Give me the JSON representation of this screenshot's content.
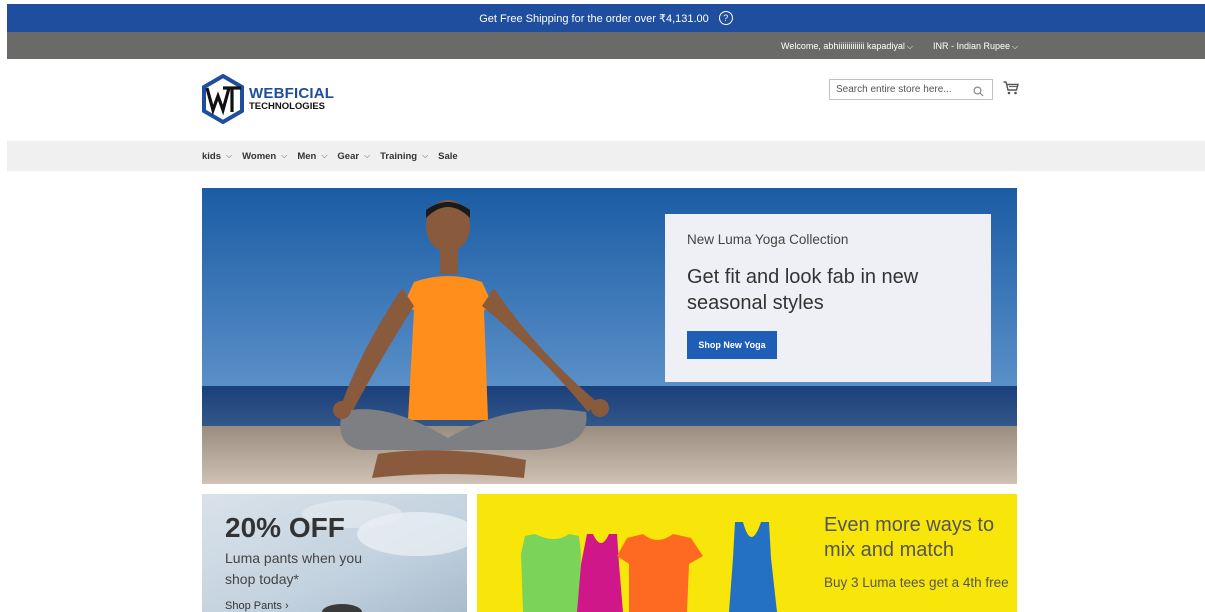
{
  "promo_bar": {
    "text": "Get Free Shipping for the order over ₹4,131.00",
    "help_icon": "?"
  },
  "user_bar": {
    "welcome": "Welcome, abhiiiiiiiiiiiii kapadiyal",
    "currency": "INR - Indian Rupee"
  },
  "logo": {
    "line1": "WEBFICIAL",
    "line2": "TECHNOLOGIES"
  },
  "search": {
    "placeholder": "Search entire store here..."
  },
  "nav": {
    "kids": "kids",
    "women": "Women",
    "men": "Men",
    "gear": "Gear",
    "training": "Training",
    "sale": "Sale"
  },
  "hero": {
    "eyebrow": "New Luma Yoga Collection",
    "headline": "Get fit and look fab in new seasonal styles",
    "cta": "Shop New Yoga"
  },
  "promo_left": {
    "headline": "20% OFF",
    "subtext": "Luma pants when you shop today*",
    "link": "Shop Pants"
  },
  "promo_right": {
    "headline": "Even more ways to mix and match",
    "subtext": "Buy 3 Luma tees get a 4th free"
  },
  "colors": {
    "brand_blue": "#1f4e9e",
    "button_blue": "#1f5eb7",
    "gray_bar": "#6a6b68",
    "promo_yellow": "#f8e60a"
  }
}
